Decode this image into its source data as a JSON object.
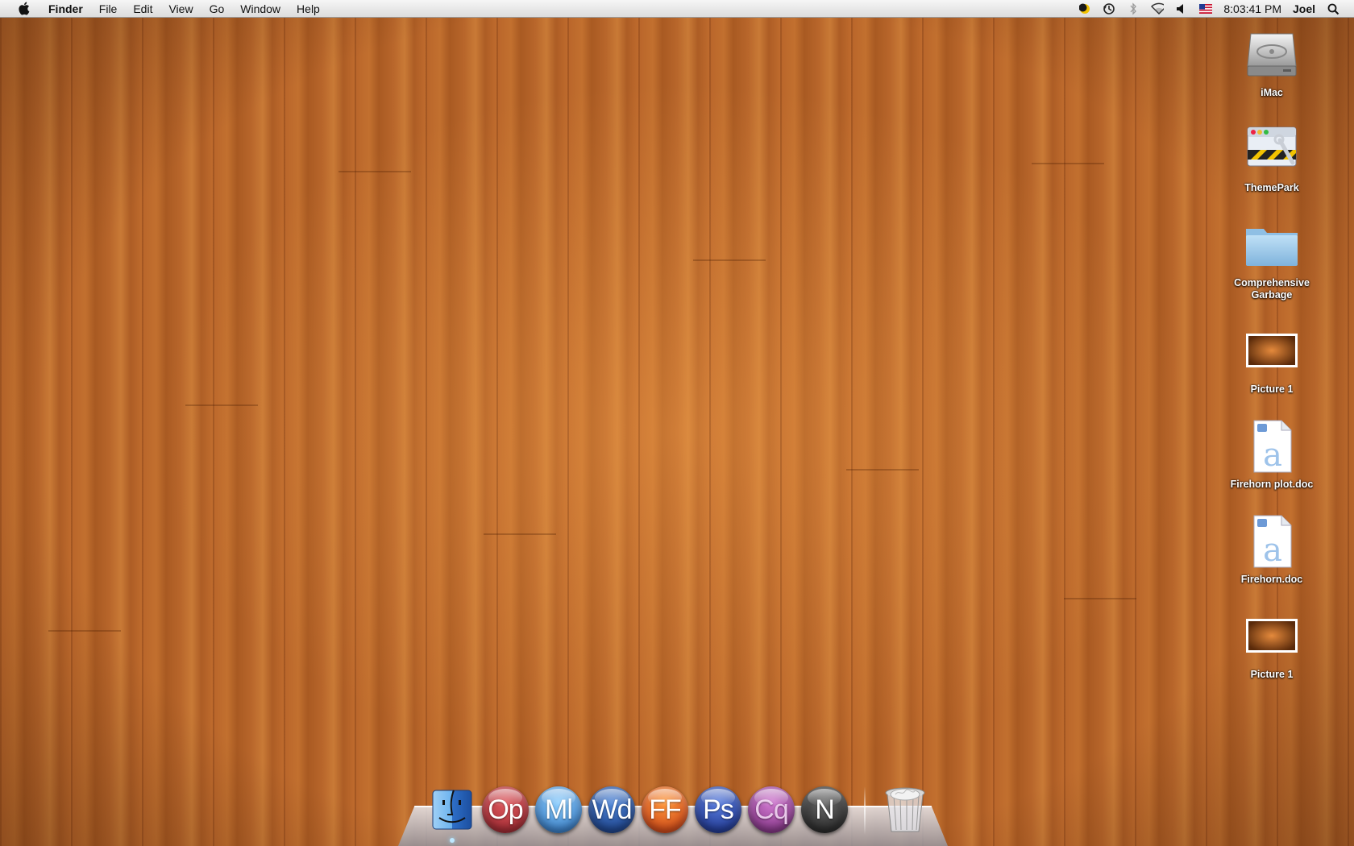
{
  "menubar": {
    "app_name": "Finder",
    "menus": [
      "File",
      "Edit",
      "View",
      "Go",
      "Window",
      "Help"
    ],
    "clock": "8:03:41 PM",
    "user": "Joel",
    "status_icons": [
      "moon-icon",
      "time-machine-icon",
      "bluetooth-icon",
      "wifi-icon",
      "volume-icon",
      "us-flag-icon",
      "spotlight-icon"
    ]
  },
  "desktop_icons": [
    {
      "label": "iMac",
      "icon": "hard-drive-icon"
    },
    {
      "label": "ThemePark",
      "icon": "themepark-app-icon"
    },
    {
      "label": "Comprehensive\nGarbage",
      "icon": "folder-icon"
    },
    {
      "label": "Picture 1",
      "icon": "picture-thumbnail-icon"
    },
    {
      "label": "Firehorn plot.doc",
      "icon": "text-document-icon"
    },
    {
      "label": "Firehorn.doc",
      "icon": "text-document-icon"
    },
    {
      "label": "Picture 1",
      "icon": "picture-thumbnail-icon"
    }
  ],
  "dock": {
    "items": [
      {
        "name": "finder",
        "text": ""
      },
      {
        "name": "opera",
        "text": "Op",
        "color": "#b8323a"
      },
      {
        "name": "mail",
        "text": "Ml",
        "color": "#2f86c9"
      },
      {
        "name": "word",
        "text": "Wd",
        "color": "#1c4f9a"
      },
      {
        "name": "firefox",
        "text": "FF",
        "color": "#e0501c"
      },
      {
        "name": "photoshop",
        "text": "Ps",
        "color": "#1c3f9e"
      },
      {
        "name": "cq",
        "text": "Cq",
        "color": "#9a3c98"
      },
      {
        "name": "n-app",
        "text": "N",
        "color": "#3a3a3a"
      }
    ],
    "trash": "trash-icon"
  }
}
